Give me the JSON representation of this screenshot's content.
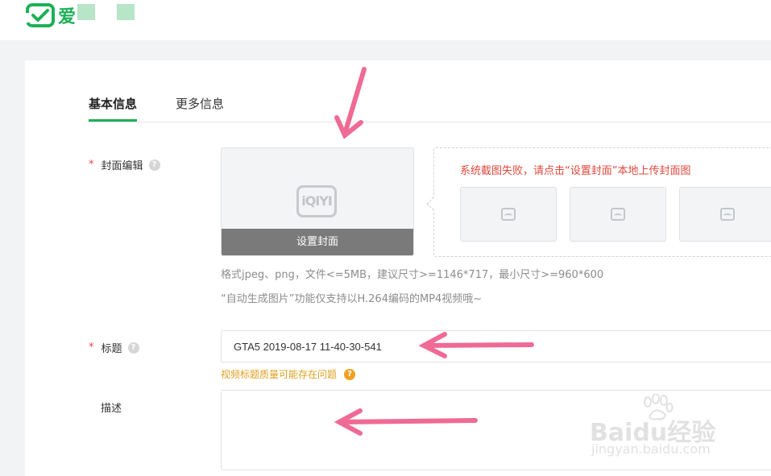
{
  "header": {
    "logo_text": "爱"
  },
  "tabs": [
    {
      "label": "基本信息",
      "active": true
    },
    {
      "label": "更多信息",
      "active": false
    }
  ],
  "cover": {
    "required_mark": "*",
    "label": "封面编辑",
    "help_icon": "question-icon",
    "placeholder_logo": "iQIYI",
    "set_button": "设置封面",
    "auto_error": "系统截图失败，请点击“设置封面”本地上传封面图",
    "thumb_icon": "image-icon",
    "format_hint": "格式jpeg、png，文件<=5MB，建议尺寸>=1146*717，最小尺寸>=960*600",
    "auto_hint": "“自动生成图片”功能仅支持以H.264编码的MP4视频哦~"
  },
  "title_field": {
    "required_mark": "*",
    "label": "标题",
    "help_icon": "question-icon",
    "value": "GTA5 2019-08-17 11-40-30-541",
    "warning": "视频标题质量可能存在问题",
    "warning_icon": "question-icon"
  },
  "description_field": {
    "label": "描述",
    "value": ""
  },
  "watermark": {
    "main": "Baidu经验",
    "sub": "jingyan.baidu.com"
  },
  "colors": {
    "brand": "#1cb057",
    "required": "#e5484d",
    "error": "#e0483d",
    "warning": "#e0a020",
    "annotation_arrow": "#ef6a94"
  }
}
